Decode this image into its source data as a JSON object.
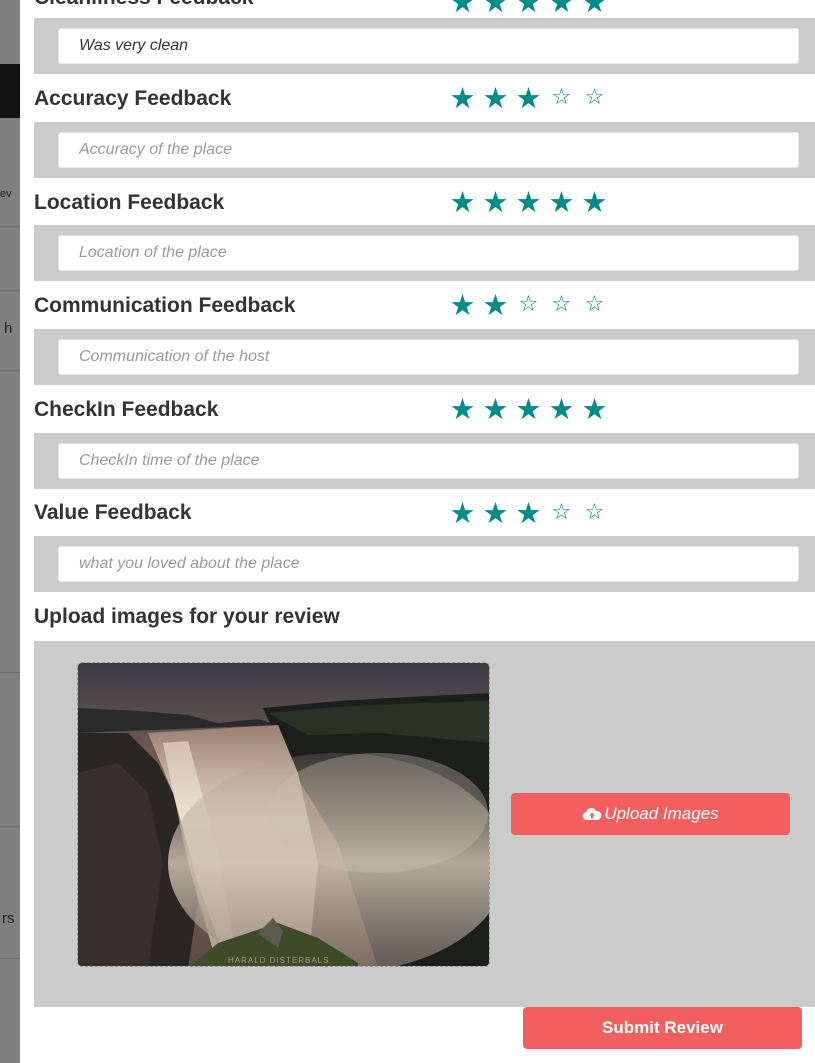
{
  "background_fragments": [
    "ev",
    "h",
    "rs"
  ],
  "top_cut": {
    "title": "Cleanliness Feedback",
    "rating": 5
  },
  "colors": {
    "star": "#008b8b",
    "accent": "#f25f5f",
    "panel": "#cbcbcb"
  },
  "comments": {
    "cleanliness": {
      "value": "Was very clean",
      "placeholder": ""
    }
  },
  "feedback": [
    {
      "title": "Accuracy Feedback",
      "rating": 3,
      "max": 5,
      "placeholder": "Accuracy of the place",
      "value": ""
    },
    {
      "title": "Location Feedback",
      "rating": 5,
      "max": 5,
      "placeholder": "Location of the place",
      "value": ""
    },
    {
      "title": "Communication Feedback",
      "rating": 2,
      "max": 5,
      "placeholder": "Communication of the host",
      "value": ""
    },
    {
      "title": "CheckIn Feedback",
      "rating": 5,
      "max": 5,
      "placeholder": "CheckIn time of the place",
      "value": ""
    },
    {
      "title": "Value Feedback",
      "rating": 3,
      "max": 5,
      "placeholder": "what you loved about the place",
      "value": ""
    }
  ],
  "upload": {
    "title": "Upload images for your review",
    "button_label": "Upload Images",
    "button_icon": "cloud-upload-icon",
    "image_caption": "waterfall-photo",
    "image_watermark": "HARALD DISTERBALS"
  },
  "submit_label": "Submit Review"
}
